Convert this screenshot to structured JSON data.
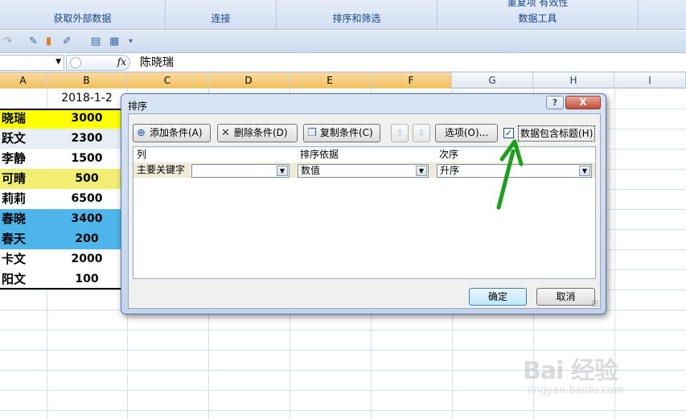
{
  "ribbon": {
    "groups": [
      "获取外部数据",
      "连接",
      "排序和筛选",
      "数据工具"
    ],
    "partial_top": "重复项 有效性"
  },
  "formula_bar": {
    "fx": "fx",
    "content": "陈晓瑞"
  },
  "columns": [
    "A",
    "B",
    "C",
    "D",
    "E",
    "F",
    "G",
    "H",
    "I"
  ],
  "sheet": {
    "header_date": "2018-1-2",
    "rows": [
      {
        "name": "晓瑞",
        "value": "3000",
        "bg": "#ffff00"
      },
      {
        "name": "跃文",
        "value": "2300",
        "bg": "#e8eef6"
      },
      {
        "name": "李静",
        "value": "1500",
        "bg": "#ffffff"
      },
      {
        "name": "可晴",
        "value": "500",
        "bg": "#f2ee73"
      },
      {
        "name": "莉莉",
        "value": "6500",
        "bg": "#ffffff"
      },
      {
        "name": "春晓",
        "value": "3400",
        "bg": "#4db5e9"
      },
      {
        "name": "春天",
        "value": "200",
        "bg": "#4db5e9"
      },
      {
        "name": "卡文",
        "value": "2000",
        "bg": "#ffffff"
      },
      {
        "name": "阳文",
        "value": "100",
        "bg": "#ffffff"
      }
    ]
  },
  "dialog": {
    "title": "排序",
    "help": "?",
    "close": "X",
    "add_condition": "添加条件(A)",
    "delete_condition": "删除条件(D)",
    "copy_condition": "复制条件(C)",
    "up": "⇧",
    "down": "⇩",
    "options": "选项(O)...",
    "checkbox_label": "数据包含标题(H)",
    "checkbox_checked": true,
    "col_header": "列",
    "sort_on_header": "排序依据",
    "order_header": "次序",
    "row_label": "主要关键字",
    "column_value": "",
    "sort_on_value": "数值",
    "order_value": "升序",
    "ok": "确定",
    "cancel": "取消"
  },
  "watermark": {
    "brand": "Bai  经验",
    "url": "jingyan.baidu.com"
  },
  "colors": {
    "accent": "#00a000",
    "ribbon": "#d3e1f3",
    "dialog_frame": "#c2d5ec"
  }
}
